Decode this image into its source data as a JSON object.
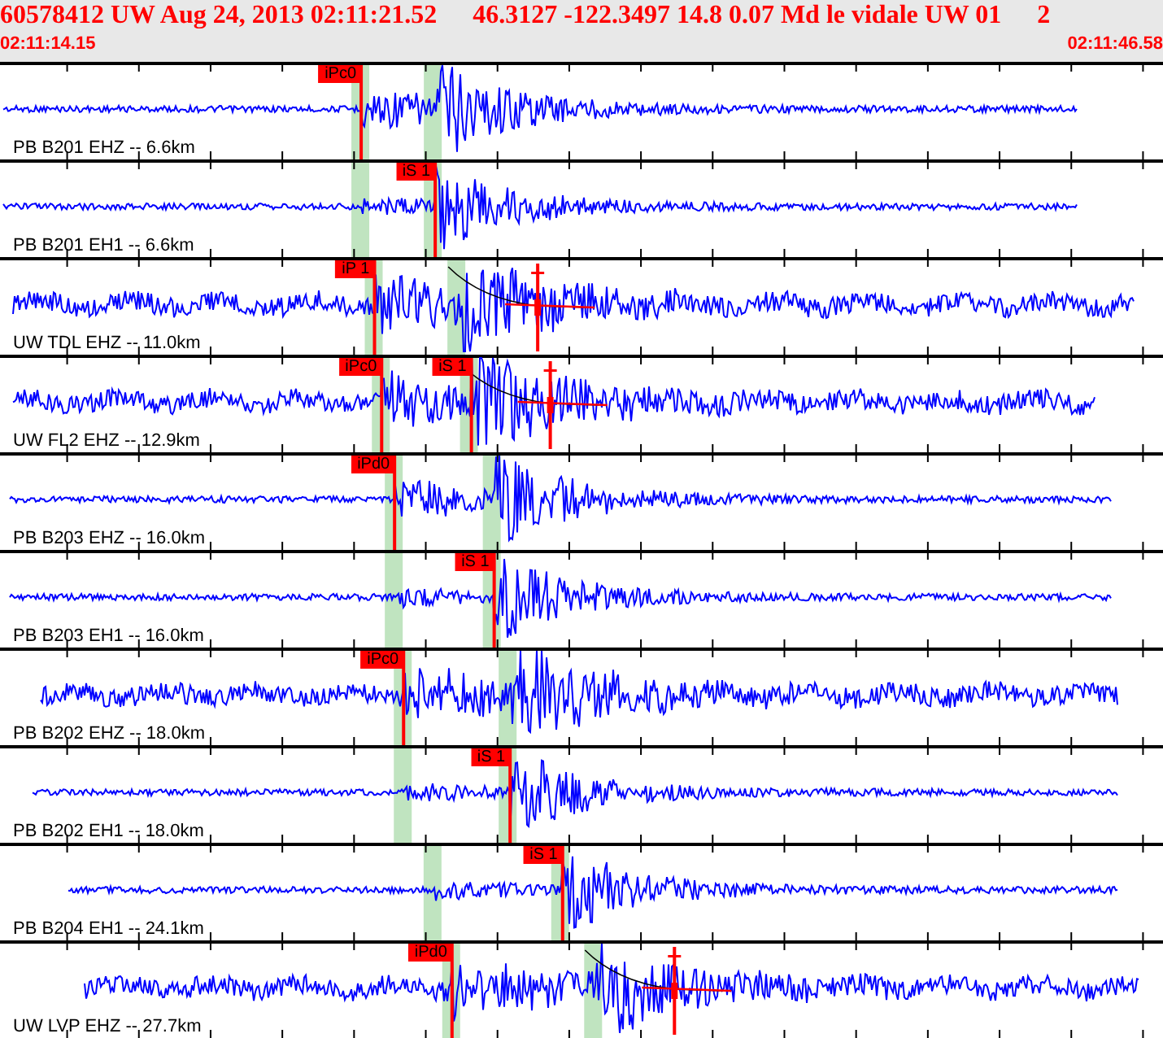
{
  "event": {
    "summary": "60578412 UW Aug 24, 2013 02:11:21.52",
    "location": "46.3127 -122.3497 14.8 0.07 Md le vidale UW 01",
    "extra": "2"
  },
  "window": {
    "start_time": "02:11:14.15",
    "end_time": "02:11:46.58"
  },
  "traces": [
    {
      "channel": "PB B201 EHZ -- 6.6km",
      "amp_marker": false,
      "picks": [
        {
          "label": "iPc0",
          "kind": "P"
        }
      ]
    },
    {
      "channel": "PB B201 EH1 -- 6.6km",
      "amp_marker": false,
      "picks": [
        {
          "label": "iS 1",
          "kind": "S"
        }
      ]
    },
    {
      "channel": "UW TDL EHZ -- 11.0km",
      "amp_marker": true,
      "picks": [
        {
          "label": "iP 1",
          "kind": "P"
        }
      ]
    },
    {
      "channel": "UW FL2 EHZ -- 12.9km",
      "amp_marker": true,
      "picks": [
        {
          "label": "iPc0",
          "kind": "P"
        },
        {
          "label": "iS 1",
          "kind": "S"
        }
      ]
    },
    {
      "channel": "PB B203 EHZ -- 16.0km",
      "amp_marker": false,
      "picks": [
        {
          "label": "iPd0",
          "kind": "P"
        }
      ]
    },
    {
      "channel": "PB B203 EH1 -- 16.0km",
      "amp_marker": false,
      "picks": [
        {
          "label": "iS 1",
          "kind": "S"
        }
      ]
    },
    {
      "channel": "PB B202 EHZ -- 18.0km",
      "amp_marker": false,
      "picks": [
        {
          "label": "iPc0",
          "kind": "P"
        }
      ]
    },
    {
      "channel": "PB B202 EH1 -- 18.0km",
      "amp_marker": false,
      "picks": [
        {
          "label": "iS 1",
          "kind": "S"
        }
      ]
    },
    {
      "channel": "PB B204 EH1 -- 24.1km",
      "amp_marker": false,
      "picks": [
        {
          "label": "iS 1",
          "kind": "S"
        }
      ]
    },
    {
      "channel": "UW LVP EHZ -- 27.7km",
      "amp_marker": true,
      "picks": [
        {
          "label": "iPd0",
          "kind": "P"
        }
      ]
    }
  ]
}
